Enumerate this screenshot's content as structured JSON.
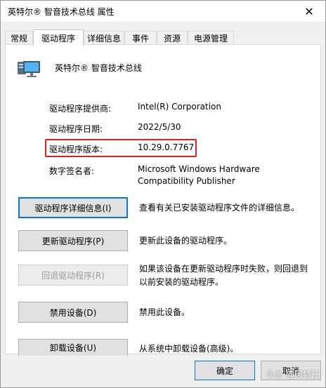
{
  "window": {
    "title": "英特尔® 智音技术总线 属性",
    "close_glyph": "✕"
  },
  "tabs": [
    {
      "label": "常规"
    },
    {
      "label": "驱动程序"
    },
    {
      "label": "详细信息"
    },
    {
      "label": "事件"
    },
    {
      "label": "资源"
    },
    {
      "label": "电源管理"
    }
  ],
  "device": {
    "name": "英特尔® 智音技术总线",
    "icon": "monitor-device-icon"
  },
  "info": [
    {
      "label": "驱动程序提供商:",
      "value": "Intel(R) Corporation"
    },
    {
      "label": "驱动程序日期:",
      "value": "2022/5/30"
    },
    {
      "label": "驱动程序版本:",
      "value": "10.29.0.7767"
    },
    {
      "label": "数字签名者:",
      "value_line1": "Microsoft Windows Hardware",
      "value_line2": "Compatibility Publisher"
    }
  ],
  "actions": [
    {
      "button": "驱动程序详细信息(I)",
      "desc": "查看有关已安装驱动程序文件的详细信息。"
    },
    {
      "button": "更新驱动程序(P)",
      "desc": "更新此设备的驱动程序。"
    },
    {
      "button": "回退驱动程序(R)",
      "desc_line1": "如果该设备在更新驱动程序时失败，则回退到",
      "desc_line2": "以前安装的驱动程序。"
    },
    {
      "button": "禁用设备(D)",
      "desc": "禁用此设备。"
    },
    {
      "button": "卸载设备(U)",
      "desc": "从系统中卸载设备(高级)。"
    }
  ],
  "footer": {
    "ok": "确定",
    "cancel": "取消"
  },
  "watermark": "头条 @因特汪",
  "colors": {
    "highlight": "#e02020",
    "focus": "#0078d7"
  }
}
